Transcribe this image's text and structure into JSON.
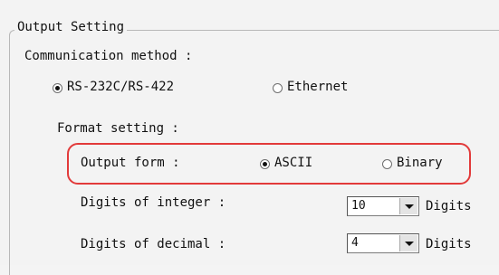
{
  "group": {
    "title": "Output Setting"
  },
  "communication": {
    "label": "Communication method :",
    "options": [
      {
        "label": "RS-232C/RS-422",
        "selected": true
      },
      {
        "label": "Ethernet",
        "selected": false
      }
    ]
  },
  "format": {
    "label": "Format setting :",
    "output_form": {
      "label": "Output form :",
      "options": [
        {
          "label": "ASCII",
          "selected": true
        },
        {
          "label": "Binary",
          "selected": false
        }
      ],
      "highlight_color": "#e23a3a"
    },
    "digits_integer": {
      "label": "Digits of integer :",
      "value": "10",
      "unit": "Digits"
    },
    "digits_decimal": {
      "label": "Digits of decimal :",
      "value": "4",
      "unit": "Digits"
    }
  }
}
